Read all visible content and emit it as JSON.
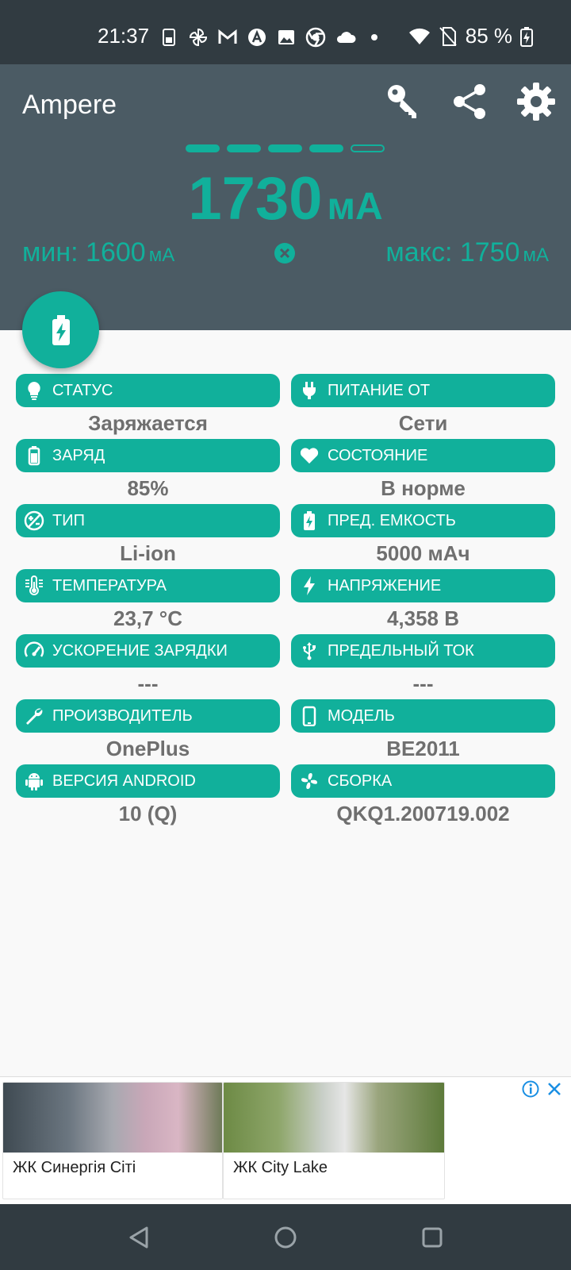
{
  "status_bar": {
    "time": "21:37",
    "battery_percent": "85 %",
    "notification_icons": [
      "sim-icon",
      "pinwheel-icon",
      "gmail-icon",
      "a-badge-icon",
      "image-icon",
      "chrome-icon",
      "cloud-icon",
      "dot-icon"
    ]
  },
  "header": {
    "app_title": "Ampere",
    "level": {
      "filled": 4,
      "total": 5
    },
    "current_value": "1730",
    "current_unit": "мА",
    "min_label": "мин: 1600",
    "min_unit": "мА",
    "max_label": "макс: 1750",
    "max_unit": "мА"
  },
  "items": [
    {
      "label": "СТАТУС",
      "value": "Заряжается",
      "icon": "bulb-icon"
    },
    {
      "label": "ПИТАНИЕ ОТ",
      "value": "Сети",
      "icon": "plug-icon"
    },
    {
      "label": "ЗАРЯД",
      "value": "85%",
      "icon": "battery-icon"
    },
    {
      "label": "СОСТОЯНИЕ",
      "value": "В норме",
      "icon": "heart-icon"
    },
    {
      "label": "ТИП",
      "value": "Li-ion",
      "icon": "chemistry-icon"
    },
    {
      "label": "ПРЕД. ЕМКОСТЬ",
      "value": "5000 мАч",
      "icon": "battery-charging-icon"
    },
    {
      "label": "ТЕМПЕРАТУРА",
      "value": "23,7 °C",
      "icon": "thermometer-icon"
    },
    {
      "label": "НАПРЯЖЕНИЕ",
      "value": "4,358 В",
      "icon": "bolt-icon"
    },
    {
      "label": "УСКОРЕНИЕ ЗАРЯДКИ",
      "value": "---",
      "icon": "speedometer-icon"
    },
    {
      "label": "ПРЕДЕЛЬНЫЙ ТОК",
      "value": "---",
      "icon": "usb-icon"
    },
    {
      "label": "ПРОИЗВОДИТЕЛЬ",
      "value": "OnePlus",
      "icon": "wrench-icon"
    },
    {
      "label": "МОДЕЛЬ",
      "value": "BE2011",
      "icon": "phone-icon"
    },
    {
      "label": "ВЕРСИЯ ANDROID",
      "value": "10 (Q)",
      "icon": "android-icon"
    },
    {
      "label": "СБОРКА",
      "value": "QKQ1.200719.002",
      "icon": "fan-icon"
    }
  ],
  "ad": {
    "cards": [
      {
        "caption": "ЖК Синергія Сіті"
      },
      {
        "caption": "ЖК City Lake"
      }
    ]
  },
  "colors": {
    "accent": "#11b09b",
    "header_bg": "#4b5b64",
    "statusbar_bg": "#313b41",
    "value_text": "#6f6f6f"
  }
}
